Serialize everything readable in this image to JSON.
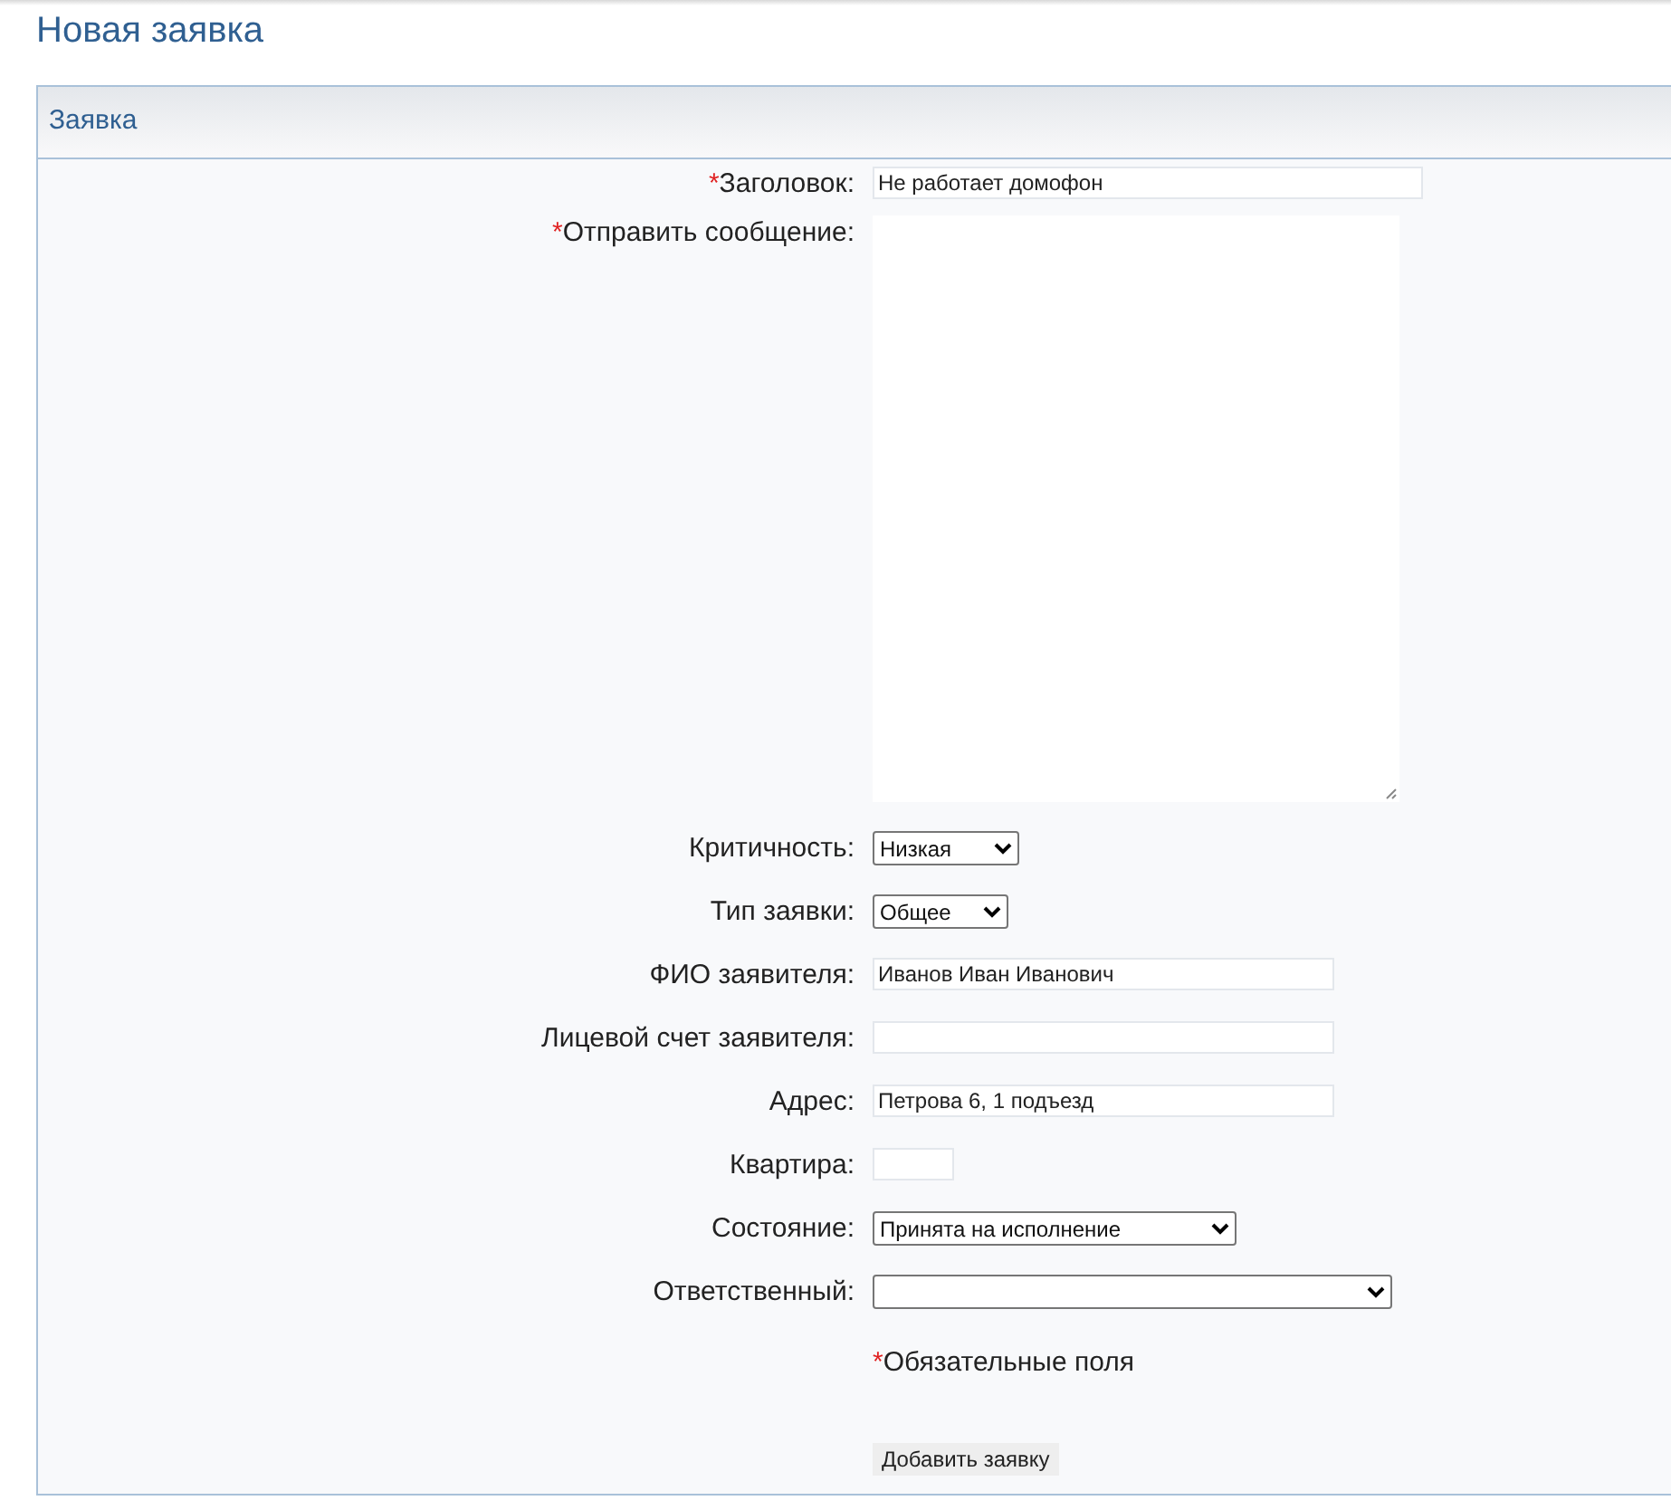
{
  "page_title": "Новая заявка",
  "panel": {
    "title": "Заявка"
  },
  "fields": [
    {
      "kind": "text",
      "label": "Заголовок:",
      "required": true,
      "value": "Не работает домофон"
    },
    {
      "kind": "textarea",
      "label": "Отправить сообщение:",
      "required": true
    },
    {
      "kind": "select",
      "label": "Критичность:",
      "required": false,
      "value": "Низкая"
    },
    {
      "kind": "select",
      "label": "Тип заявки:",
      "required": false,
      "value": "Общее"
    },
    {
      "kind": "text",
      "label": "ФИО заявителя:",
      "required": false,
      "value": "Иванов Иван Иванович"
    },
    {
      "kind": "text",
      "label": "Лицевой счет заявителя:",
      "required": false
    },
    {
      "kind": "text",
      "label": "Адрес:",
      "required": false,
      "value": "Петрова 6, 1 подъезд"
    },
    {
      "kind": "text",
      "label": "Квартира:",
      "required": false
    },
    {
      "kind": "select",
      "label": "Состояние:",
      "required": false,
      "value": "Принята на исполнение"
    },
    {
      "kind": "select",
      "label": "Ответственный:",
      "required": false
    }
  ],
  "required_note": {
    "mark": "*",
    "text": "Обязательные поля"
  },
  "submit_button": "Добавить заявку"
}
